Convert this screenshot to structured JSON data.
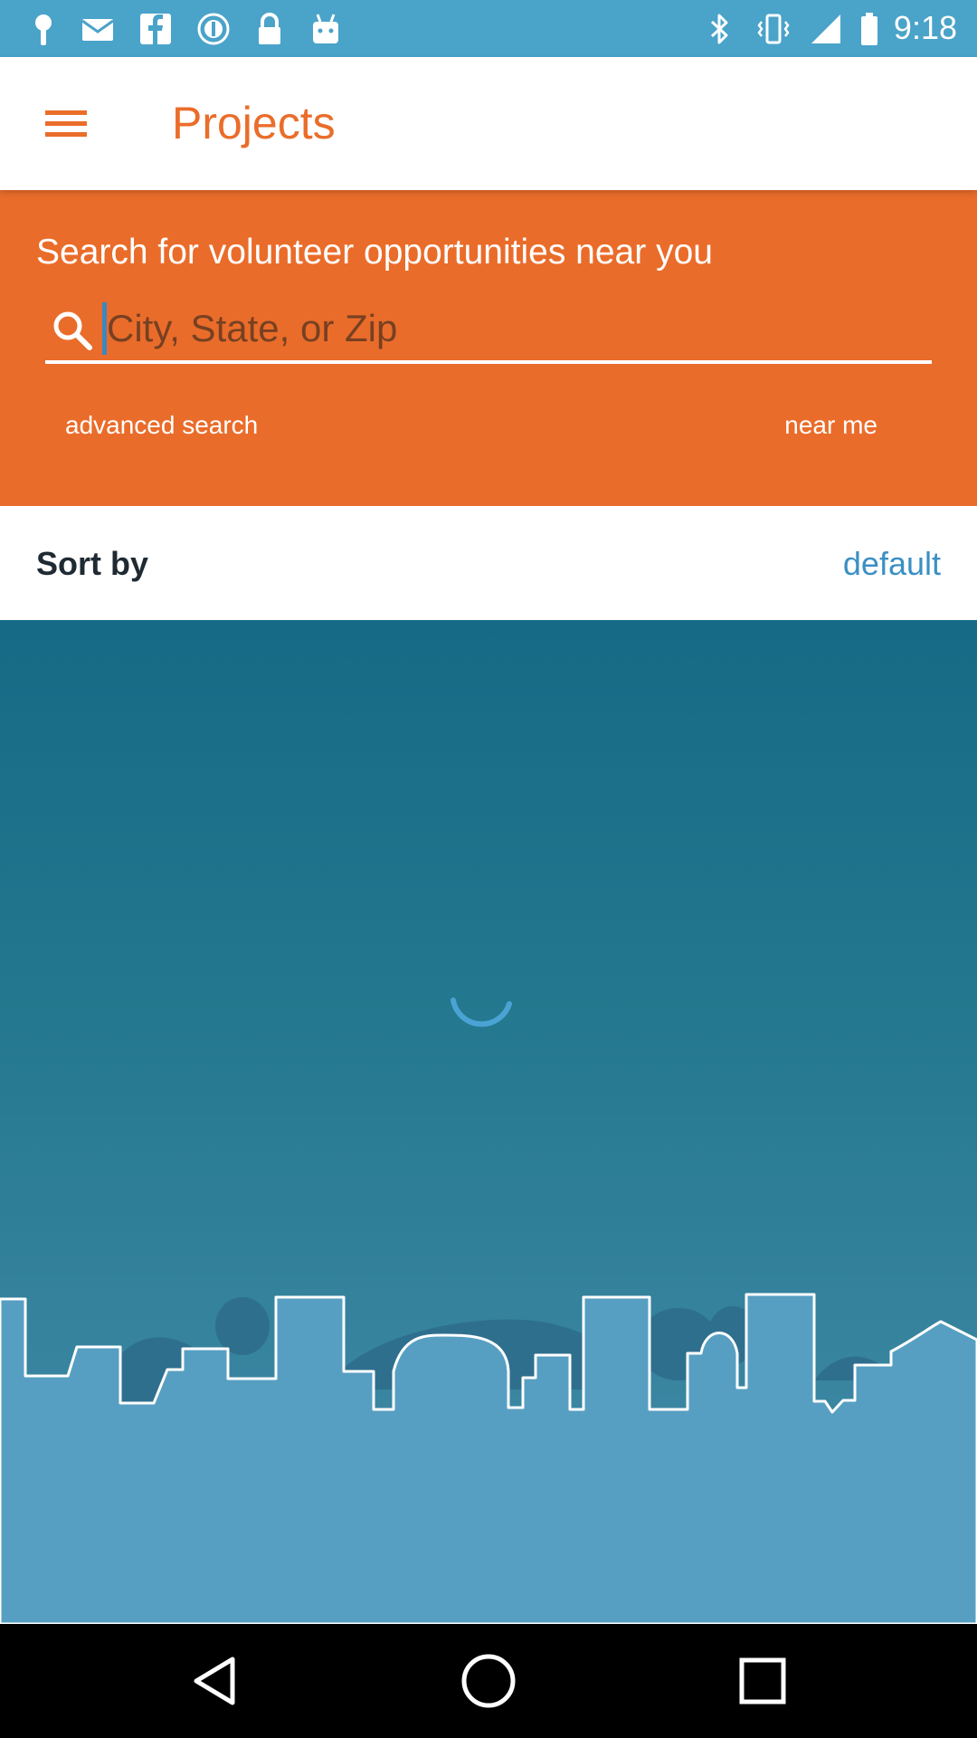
{
  "status_bar": {
    "time": "9:18",
    "left_icons": [
      "location-pin-icon",
      "mail-icon",
      "facebook-icon",
      "info-icon",
      "lock-icon",
      "android-icon"
    ],
    "right_icons": [
      "bluetooth-icon",
      "vibrate-icon",
      "signal-icon",
      "battery-icon"
    ]
  },
  "app_bar": {
    "title": "Projects",
    "menu_icon": "hamburger-menu-icon"
  },
  "search": {
    "heading": "Search for volunteer opportunities near you",
    "placeholder": "City, State, or Zip",
    "value": "",
    "advanced_link": "advanced search",
    "near_me_link": "near me"
  },
  "sort": {
    "label": "Sort by",
    "value": "default"
  },
  "content": {
    "loading_icon": "loading-spinner-icon",
    "illustration": "city-skyline"
  },
  "nav_bar": {
    "buttons": [
      "back-icon",
      "home-icon",
      "recents-icon"
    ]
  },
  "colors": {
    "status_bar": "#4aa3c9",
    "accent_orange": "#ea6c2a",
    "link_blue": "#3a90c4",
    "content_top": "#166a85",
    "skyline_fill": "#579fc2"
  }
}
